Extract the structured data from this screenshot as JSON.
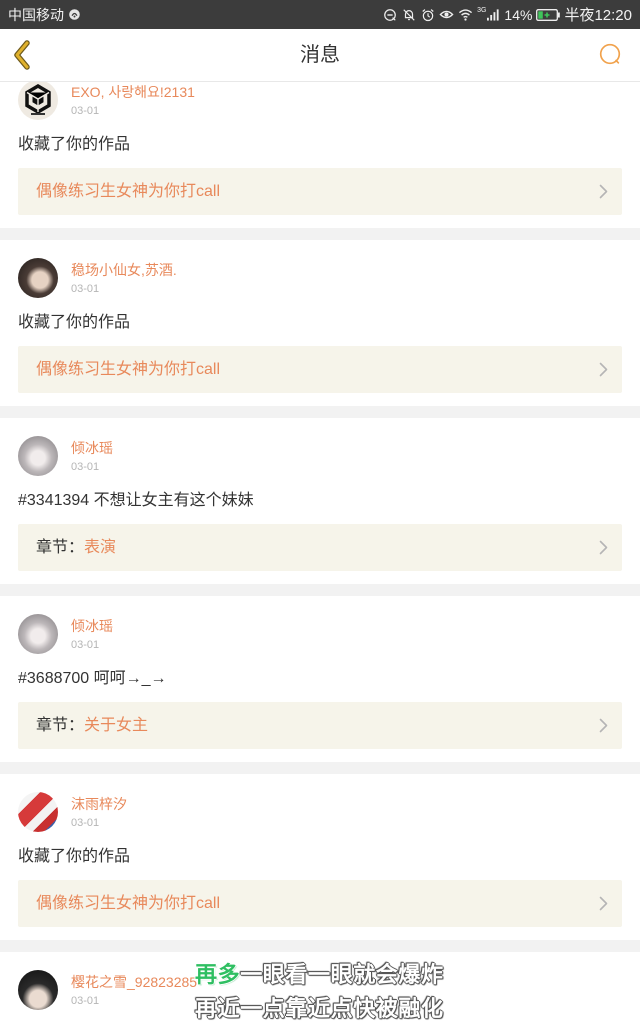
{
  "status_bar": {
    "carrier": "中国移动",
    "network": "3G",
    "battery": "14%",
    "time": "半夜12:20",
    "icons": [
      "app-notification-icon",
      "do-not-disturb-icon",
      "mute-icon",
      "alarm-icon",
      "eye-comfort-icon",
      "wifi-icon",
      "signal-icon",
      "battery-icon"
    ]
  },
  "header": {
    "title": "消息",
    "back_icon": "back-chevron-icon",
    "action_icon": "search-icon"
  },
  "messages": [
    {
      "name": "EXO, 사랑해요!2131",
      "date": "03-01",
      "content": "收藏了你的作品",
      "link_text": "偶像练习生女神为你打call"
    },
    {
      "name": "稳场小仙女,苏酒.",
      "date": "03-01",
      "content": "收藏了你的作品",
      "link_text": "偶像练习生女神为你打call"
    },
    {
      "name": "倾冰瑶",
      "date": "03-01",
      "content": "#3341394 不想让女主有这个妹妹",
      "link_prefix": "章节：",
      "link_text": "表演"
    },
    {
      "name": "倾冰瑶",
      "date": "03-01",
      "content": "#3688700 呵呵→_→",
      "link_prefix": "章节：",
      "link_text": "关于女主"
    },
    {
      "name": "沫雨梓汐",
      "date": "03-01",
      "content": "收藏了你的作品",
      "link_text": "偶像练习生女神为你打call"
    },
    {
      "name": "樱花之雪_92823285",
      "date": "03-01"
    }
  ],
  "lyrics": {
    "line1_highlight": "再多",
    "line1_rest": "一眼看一眼就会爆炸",
    "line2": "再近一点靠近点快被融化"
  },
  "colors": {
    "accent": "#e8895b",
    "box_bg": "#f6f4ea",
    "separator": "#f2f2f2",
    "status_bar_bg": "#3c3c3c",
    "back_arrow": "#e0b12c",
    "icon_orange": "#f1a24c",
    "lyric_highlight": "#2fbf62"
  }
}
